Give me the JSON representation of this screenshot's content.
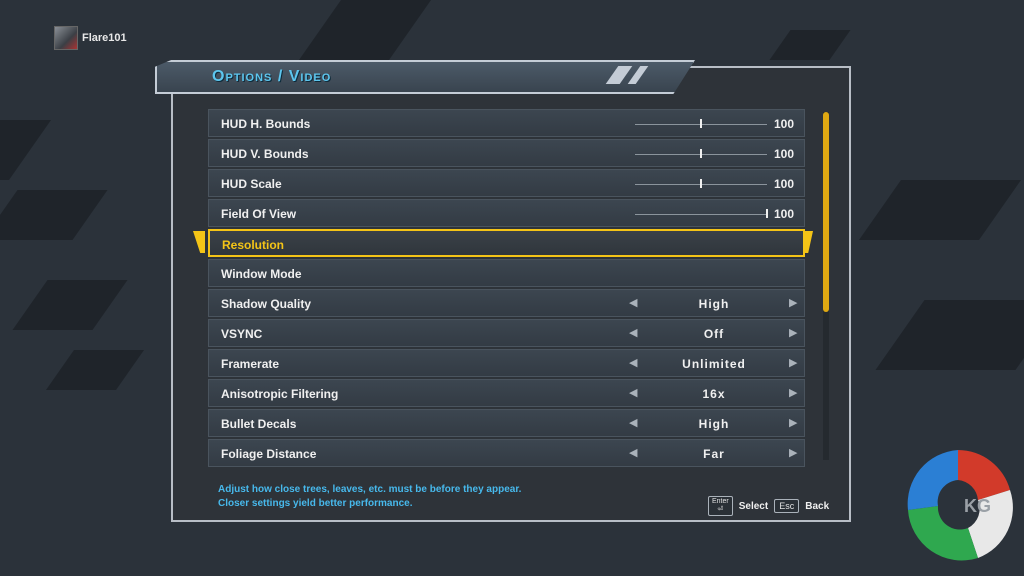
{
  "user": {
    "name": "Flare101"
  },
  "header": {
    "title": "Options / Video"
  },
  "settings": [
    {
      "label": "HUD H. Bounds",
      "type": "slider",
      "value": "100",
      "level": 0.5
    },
    {
      "label": "HUD V. Bounds",
      "type": "slider",
      "value": "100",
      "level": 0.5
    },
    {
      "label": "HUD Scale",
      "type": "slider",
      "value": "100",
      "level": 0.5
    },
    {
      "label": "Field Of View",
      "type": "slider",
      "value": "100",
      "level": 1.0
    },
    {
      "label": "Resolution",
      "type": "plain",
      "selected": true
    },
    {
      "label": "Window Mode",
      "type": "plain"
    },
    {
      "label": "Shadow Quality",
      "type": "option",
      "value": "High"
    },
    {
      "label": "VSYNC",
      "type": "option",
      "value": "Off"
    },
    {
      "label": "Framerate",
      "type": "option",
      "value": "Unlimited"
    },
    {
      "label": "Anisotropic Filtering",
      "type": "option",
      "value": "16x"
    },
    {
      "label": "Bullet Decals",
      "type": "option",
      "value": "High"
    },
    {
      "label": "Foliage Distance",
      "type": "option",
      "value": "Far"
    }
  ],
  "scrollbar": {
    "thumb_fraction": 0.58,
    "position": 0.0
  },
  "hint": {
    "line1": "Adjust how close trees, leaves, etc. must be before they appear.",
    "line2": "Closer settings yield better performance."
  },
  "footer": {
    "enter_key": "Enter",
    "select_label": "Select",
    "esc_key": "Esc",
    "back_label": "Back"
  },
  "icons": {
    "arrow_left": "triangle-left-icon",
    "arrow_right": "triangle-right-icon"
  },
  "colors": {
    "accent": "#f4c417",
    "title": "#5dc6ee",
    "hint": "#47b9ec"
  }
}
